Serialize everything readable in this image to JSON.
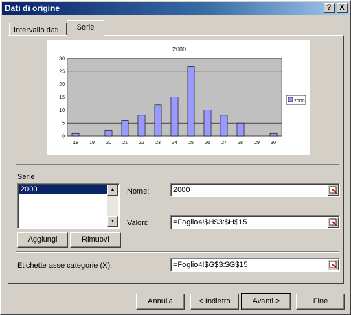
{
  "window": {
    "title": "Dati di origine"
  },
  "titlebar_buttons": {
    "help": "?",
    "close": "X"
  },
  "tabs": [
    {
      "label": "Intervallo dati"
    },
    {
      "label": "Serie"
    }
  ],
  "serie_section": {
    "label": "Serie",
    "items": [
      "2000"
    ]
  },
  "fields": {
    "nome": {
      "label": "Nome:",
      "value": "2000"
    },
    "valori": {
      "label": "Valori:",
      "value": "=Foglio4!$H$3:$H$15"
    },
    "etichette": {
      "label": "Etichette asse categorie (X):",
      "value": "=Foglio4!$G$3:$G$15"
    }
  },
  "list_buttons": {
    "add": "Aggiungi",
    "remove": "Rimuovi"
  },
  "footer_buttons": {
    "cancel": "Annulla",
    "back": "< Indietro",
    "next": "Avanti >",
    "finish": "Fine"
  },
  "colors": {
    "bar_fill": "#9999ff",
    "plot_bg": "#c0c0c0",
    "titlebar": "#0a246a"
  },
  "chart_data": {
    "type": "bar",
    "title": "2000",
    "categories": [
      "18",
      "19",
      "20",
      "21",
      "22",
      "23",
      "24",
      "25",
      "26",
      "27",
      "28",
      "29",
      "30"
    ],
    "series": [
      {
        "name": "2000",
        "values": [
          1,
          0,
          2,
          6,
          8,
          12,
          15,
          27,
          10,
          8,
          5,
          0,
          1
        ]
      }
    ],
    "yticks": [
      "0",
      "5",
      "10",
      "15",
      "20",
      "25",
      "30"
    ],
    "ylim": [
      0,
      30
    ],
    "grid": true,
    "legend": "right"
  }
}
